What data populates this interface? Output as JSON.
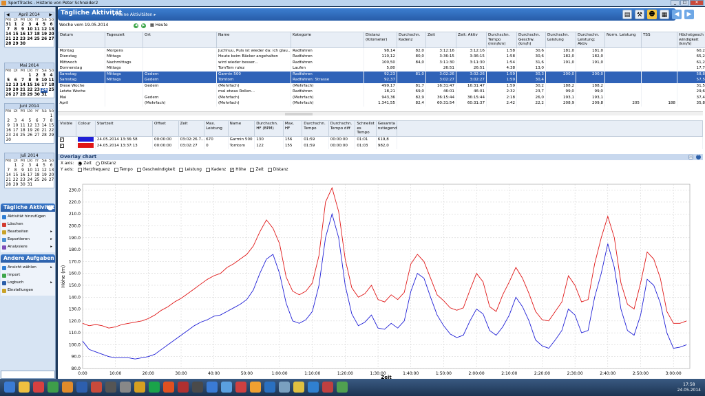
{
  "window": {
    "title": "SportTracks - Historie von Peter Schneider2"
  },
  "calendars": [
    {
      "month": "April 2014",
      "days": [
        [
          "31",
          "1",
          "2",
          "3",
          "4",
          "5",
          "6"
        ],
        [
          "7",
          "8",
          "9",
          "10",
          "11",
          "12",
          "13"
        ],
        [
          "14",
          "15",
          "16",
          "17",
          "18",
          "19",
          "20"
        ],
        [
          "21",
          "22",
          "23",
          "24",
          "25",
          "26",
          "27"
        ],
        [
          "28",
          "29",
          "30",
          "",
          "",
          "",
          ""
        ]
      ]
    },
    {
      "month": "Mai 2014",
      "days": [
        [
          "",
          "",
          "",
          "1",
          "2",
          "3",
          "4"
        ],
        [
          "5",
          "6",
          "7",
          "8",
          "9",
          "10",
          "11"
        ],
        [
          "12",
          "13",
          "14",
          "15",
          "16",
          "17",
          "18"
        ],
        [
          "19",
          "20",
          "21",
          "22",
          "23",
          "24",
          "25"
        ],
        [
          "26",
          "27",
          "28",
          "29",
          "30",
          "31",
          ""
        ]
      ],
      "selected": "24"
    },
    {
      "month": "Juni 2014",
      "days": [
        [
          "",
          "",
          "",
          "",
          "",
          "",
          "1"
        ],
        [
          "2",
          "3",
          "4",
          "5",
          "6",
          "7",
          "8"
        ],
        [
          "9",
          "10",
          "11",
          "12",
          "13",
          "14",
          "15"
        ],
        [
          "16",
          "17",
          "18",
          "19",
          "20",
          "21",
          "22"
        ],
        [
          "23",
          "24",
          "25",
          "26",
          "27",
          "28",
          "29"
        ],
        [
          "30",
          "",
          "",
          "",
          "",
          "",
          ""
        ]
      ]
    },
    {
      "month": "Juli 2014",
      "days": [
        [
          "",
          "1",
          "2",
          "3",
          "4",
          "5",
          "6"
        ],
        [
          "7",
          "8",
          "9",
          "10",
          "11",
          "12",
          "13"
        ],
        [
          "14",
          "15",
          "16",
          "17",
          "18",
          "19",
          "20"
        ],
        [
          "21",
          "22",
          "23",
          "24",
          "25",
          "26",
          "27"
        ],
        [
          "28",
          "29",
          "30",
          "31",
          "",
          "",
          ""
        ]
      ]
    }
  ],
  "weekdays": [
    "Mo",
    "Di",
    "Mi",
    "Do",
    "Fr",
    "Sa",
    "So"
  ],
  "tasks1": {
    "title": "Tägliche Aktivität",
    "items": [
      {
        "label": "Aktivität hinzufügen",
        "icon": "add-icon",
        "color": "#2e7dd2"
      },
      {
        "label": "Löschen",
        "icon": "delete-icon",
        "color": "#d23a2e"
      },
      {
        "label": "Bearbeiten",
        "icon": "edit-icon",
        "color": "#c9a227",
        "arrow": "▸"
      },
      {
        "label": "Exportieren",
        "icon": "export-icon",
        "color": "#4a8fd0",
        "arrow": "▸"
      },
      {
        "label": "Analysiere",
        "icon": "analyze-icon",
        "color": "#7c4db8",
        "arrow": "▸"
      }
    ]
  },
  "tasks2": {
    "title": "Andere Aufgaben",
    "items": [
      {
        "label": "Ansicht wählen",
        "icon": "view-icon",
        "color": "#2e7dd2",
        "arrow": "▸"
      },
      {
        "label": "Import",
        "icon": "import-icon",
        "color": "#3ea64a"
      },
      {
        "label": "Logbuch",
        "icon": "logbook-icon",
        "color": "#2a5ea8",
        "arrow": "▸"
      },
      {
        "label": "Einstellungen",
        "icon": "settings-icon",
        "color": "#c9a227"
      }
    ]
  },
  "header": {
    "title": "Tägliche Aktivität",
    "breadcrumb": "▸ Meine Aktivitäten ▸",
    "week": "Woche vom 19.05.2014",
    "today": "Heute"
  },
  "activity_columns": [
    "Datum",
    "Tageszeit",
    "Ort",
    "Name",
    "Kategorie",
    "Distanz (Kilometer)",
    "Durchschn. Kadenz",
    "Zeit",
    "Zeit: Aktiv",
    "Durchschn. Tempo (min/km)",
    "Durchschn. Geschw. (km/h)",
    "Durchschn. Leistung",
    "Durchschn. Leistung: Aktiv",
    "Norm. Leistung",
    "TSS",
    "Höchstgesch windigkeit (km/h)"
  ],
  "activity_rows": [
    {
      "cells": [
        "Montag",
        "Morgens",
        "",
        "Juchhuu, Puls ist wieder da: ich glau...",
        "Radfahren",
        "98,14",
        "82,0",
        "3:12:16",
        "3:12:16",
        "1:58",
        "30,6",
        "181,0",
        "181,0",
        "",
        "",
        "60,2"
      ]
    },
    {
      "cells": [
        "Dienstag",
        "Mittags",
        "",
        "Heute beim Bäcker angehalten",
        "Radfahren",
        "110,12",
        "80,0",
        "3:36:15",
        "3:36:15",
        "1:58",
        "30,6",
        "182,0",
        "182,0",
        "",
        "",
        "65,2"
      ]
    },
    {
      "cells": [
        "Mittwoch",
        "Nachmittags",
        "",
        "wird wieder besser...",
        "Radfahren",
        "100,50",
        "84,0",
        "3:11:30",
        "3:11:30",
        "1:54",
        "31,6",
        "191,0",
        "191,0",
        "",
        "",
        "61,2"
      ]
    },
    {
      "cells": [
        "Donnerstag",
        "Mittags",
        "",
        "TomTom rulez",
        "Laufen",
        "5,80",
        "",
        "26:51",
        "26:51",
        "4:38",
        "13,0",
        "",
        "",
        "",
        "",
        "17,7"
      ]
    },
    {
      "cells": [
        "Samstag",
        "Mittags",
        "Gedern",
        "Garmin 500",
        "Radfahren",
        "92,23",
        "81,0",
        "3:02:26",
        "3:02:26",
        "1:59",
        "30,3",
        "200,0",
        "200,0",
        "",
        "",
        "58,8"
      ],
      "selected": true
    },
    {
      "cells": [
        "Samstag",
        "Mittags",
        "Gedern",
        "Tomtom",
        "Radfahren: Strasse",
        "92,37",
        "",
        "3:02:27",
        "3:02:27",
        "1:59",
        "30,4",
        "",
        "",
        "",
        "",
        "57,5"
      ],
      "selected": true
    },
    {
      "cells": [
        "Diese Woche",
        "",
        "Gedern",
        "(Mehrfach)",
        "(Mehrfach)",
        "499,17",
        "81,7",
        "16:31:47",
        "16:31:47",
        "1:59",
        "30,2",
        "188,2",
        "188,2",
        "",
        "",
        "31,5"
      ]
    },
    {
      "cells": [
        "Letzte Woche",
        "",
        "",
        "mal etwas Rollen...",
        "Radfahren",
        "18,21",
        "69,0",
        "46:01",
        "46:01",
        "2:32",
        "23,7",
        "99,0",
        "99,0",
        "",
        "",
        "29,6"
      ]
    },
    {
      "cells": [
        "Mai",
        "",
        "Gedern",
        "(Mehrfach)",
        "(Mehrfach)",
        "943,36",
        "82,9",
        "36:15:44",
        "36:15:44",
        "2:18",
        "26,0",
        "193,1",
        "193,1",
        "",
        "",
        "37,4"
      ]
    },
    {
      "cells": [
        "April",
        "",
        "(Mehrfach)",
        "(Mehrfach)",
        "(Mehrfach)",
        "1.341,55",
        "82,4",
        "60:31:54",
        "60:31:37",
        "2:42",
        "22,2",
        "208,9",
        "209,8",
        "205",
        "188",
        "35,8"
      ]
    }
  ],
  "overlay_columns": [
    "Visible",
    "Colour",
    "Startzeit",
    "Offset",
    "Zeit",
    "Max. Leistung",
    "Name",
    "Durchschn. HF (BPM)",
    "Max. HF",
    "Durchschn. Tempo",
    "Durchschn. Tempo diff",
    "Schnellst es Tempo",
    "Gesamta nstiegend"
  ],
  "overlay_rows": [
    {
      "check": "✓",
      "color": "#1f1fd6",
      "cells": [
        "24.05.2014 13:36:58",
        "00:00:00",
        "03:02:26.7...",
        "670",
        "Garmin 500",
        "130",
        "156",
        "01:59",
        "00:00:00",
        "01:01",
        "619,8"
      ]
    },
    {
      "check": "✓",
      "color": "#e01616",
      "cells": [
        "24.05.2014 13:37:13",
        "00:00:00",
        "03:02:27",
        "0",
        "Tomtom",
        "122",
        "155",
        "01:59",
        "00:00:00",
        "01:03",
        "982,0"
      ]
    }
  ],
  "overlay": {
    "title": "Overlay chart",
    "xaxis_label": "X axis:",
    "xaxis_options": [
      {
        "label": "Zeit",
        "checked": true
      },
      {
        "label": "Distanz",
        "checked": false
      }
    ],
    "yaxis_label": "Y axis:",
    "yaxis_options": [
      {
        "label": "Herzfrequenz",
        "checked": false
      },
      {
        "label": "Tempo",
        "checked": false
      },
      {
        "label": "Geschwindigkeit",
        "checked": false
      },
      {
        "label": "Leistung",
        "checked": false
      },
      {
        "label": "Kadenz",
        "checked": false
      },
      {
        "label": "Höhe",
        "checked": true
      },
      {
        "label": "Zeit",
        "checked": false
      },
      {
        "label": "Distanz",
        "checked": false
      }
    ]
  },
  "chart_data": {
    "type": "line",
    "title": "",
    "xlabel": "Zeit",
    "ylabel": "Höhe (m)",
    "xlim": [
      0,
      185
    ],
    "ylim": [
      80,
      235
    ],
    "yticks": [
      "80.0",
      "90.0",
      "100.0",
      "110.0",
      "120.0",
      "130.0",
      "140.0",
      "150.0",
      "160.0",
      "170.0",
      "180.0",
      "190.0",
      "200.0",
      "210.0",
      "220.0",
      "230.0"
    ],
    "xticks": [
      "0:00",
      "10:00",
      "20:00",
      "30:00",
      "40:00",
      "50:00",
      "1:00:00",
      "1:10:00",
      "1:20:00",
      "1:30:00",
      "1:40:00",
      "1:50:00",
      "2:00:00",
      "2:10:00",
      "2:20:00",
      "2:30:00",
      "2:40:00",
      "2:50:00",
      "3:00:00"
    ],
    "x": [
      0,
      2,
      4,
      6,
      8,
      10,
      12,
      14,
      16,
      18,
      20,
      22,
      24,
      26,
      28,
      30,
      32,
      34,
      36,
      38,
      40,
      42,
      44,
      46,
      48,
      50,
      52,
      54,
      56,
      58,
      60,
      62,
      64,
      66,
      68,
      70,
      72,
      74,
      76,
      78,
      80,
      82,
      84,
      86,
      88,
      90,
      92,
      94,
      96,
      98,
      100,
      102,
      104,
      106,
      108,
      110,
      112,
      114,
      116,
      118,
      120,
      122,
      124,
      126,
      128,
      130,
      132,
      134,
      136,
      138,
      140,
      142,
      144,
      146,
      148,
      150,
      152,
      154,
      156,
      158,
      160,
      162,
      164,
      166,
      168,
      170,
      172,
      174,
      176,
      178,
      180,
      182,
      184
    ],
    "series": [
      {
        "name": "Garmin 500",
        "color": "#1f1fd6",
        "values": [
          103,
          96,
          94,
          92,
          90,
          89,
          89,
          89,
          88,
          89,
          90,
          92,
          96,
          100,
          104,
          108,
          112,
          116,
          119,
          121,
          124,
          125,
          128,
          131,
          134,
          138,
          146,
          160,
          172,
          176,
          160,
          135,
          120,
          118,
          121,
          128,
          150,
          190,
          210,
          190,
          150,
          126,
          116,
          119,
          125,
          114,
          113,
          118,
          114,
          120,
          145,
          160,
          156,
          140,
          125,
          116,
          109,
          106,
          108,
          120,
          130,
          126,
          112,
          108,
          115,
          125,
          140,
          132,
          120,
          104,
          99,
          97,
          104,
          112,
          130,
          125,
          110,
          112,
          140,
          160,
          185,
          165,
          130,
          112,
          108,
          125,
          155,
          150,
          135,
          110,
          97,
          98,
          100
        ]
      },
      {
        "name": "Tomtom",
        "color": "#e01616",
        "values": [
          118,
          116,
          117,
          116,
          114,
          115,
          117,
          118,
          119,
          120,
          122,
          125,
          129,
          132,
          136,
          139,
          143,
          147,
          151,
          155,
          158,
          160,
          165,
          168,
          172,
          176,
          183,
          195,
          205,
          198,
          185,
          157,
          145,
          142,
          145,
          152,
          175,
          220,
          232,
          212,
          172,
          148,
          140,
          143,
          150,
          138,
          136,
          142,
          138,
          144,
          168,
          176,
          170,
          156,
          142,
          137,
          131,
          129,
          131,
          146,
          160,
          153,
          132,
          128,
          142,
          153,
          165,
          156,
          143,
          128,
          121,
          120,
          128,
          136,
          158,
          150,
          136,
          138,
          168,
          190,
          208,
          190,
          152,
          134,
          130,
          152,
          178,
          172,
          156,
          128,
          118,
          118,
          120
        ]
      }
    ]
  }
}
